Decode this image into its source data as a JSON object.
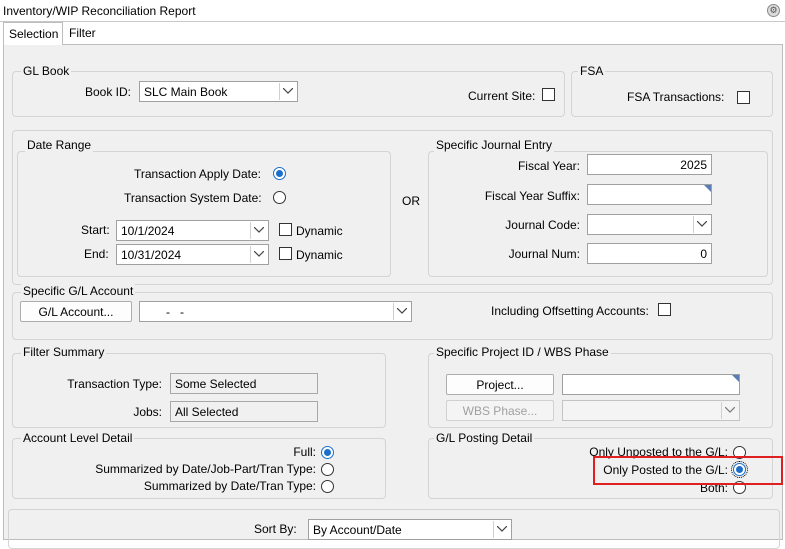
{
  "window": {
    "title": "Inventory/WIP Reconciliation Report"
  },
  "tabs": [
    {
      "label": "Selection"
    },
    {
      "label": "Filter"
    }
  ],
  "gl_book": {
    "group_label": "GL Book",
    "book_id_label": "Book ID:",
    "book_id_value": "SLC Main Book",
    "current_site_label": "Current Site:",
    "current_site_checked": false
  },
  "fsa": {
    "group_label": "FSA",
    "transactions_label": "FSA Transactions:",
    "transactions_checked": false
  },
  "date_range": {
    "group_label": "Date Range",
    "apply_date_label": "Transaction Apply Date:",
    "system_date_label": "Transaction System Date:",
    "selected": "apply",
    "start_label": "Start:",
    "start_value": "10/1/2024",
    "end_label": "End:",
    "end_value": "10/31/2024",
    "dynamic_label": "Dynamic"
  },
  "or_label": "OR",
  "journal_entry": {
    "group_label": "Specific Journal Entry",
    "fiscal_year_label": "Fiscal Year:",
    "fiscal_year_value": "2025",
    "fy_suffix_label": "Fiscal Year Suffix:",
    "fy_suffix_value": "",
    "journal_code_label": "Journal Code:",
    "journal_code_value": "",
    "journal_num_label": "Journal Num:",
    "journal_num_value": "0"
  },
  "gl_account": {
    "group_label": "Specific G/L Account",
    "button_label": "G/L Account...",
    "account_value": "-   -",
    "offsetting_label": "Including Offsetting Accounts:",
    "offsetting_checked": false
  },
  "filter_summary": {
    "group_label": "Filter Summary",
    "transaction_type_label": "Transaction Type:",
    "transaction_type_value": "Some Selected",
    "jobs_label": "Jobs:",
    "jobs_value": "All Selected"
  },
  "project": {
    "group_label": "Specific Project ID / WBS Phase",
    "project_button": "Project...",
    "project_value": "",
    "wbs_button": "WBS Phase...",
    "wbs_value": ""
  },
  "account_level": {
    "group_label": "Account Level Detail",
    "full_label": "Full:",
    "summ_job_label": "Summarized by Date/Job-Part/Tran Type:",
    "summ_tran_label": "Summarized by Date/Tran Type:",
    "selected": "full"
  },
  "posting_detail": {
    "group_label": "G/L Posting Detail",
    "unposted_label": "Only Unposted to the G/L:",
    "posted_label": "Only Posted to the G/L:",
    "both_label": "Both:",
    "selected": "posted"
  },
  "sort": {
    "label": "Sort By:",
    "value": "By Account/Date"
  },
  "colors": {
    "accent": "#1a6fc9",
    "highlight": "#e02020",
    "panel": "#f0f0f0"
  }
}
